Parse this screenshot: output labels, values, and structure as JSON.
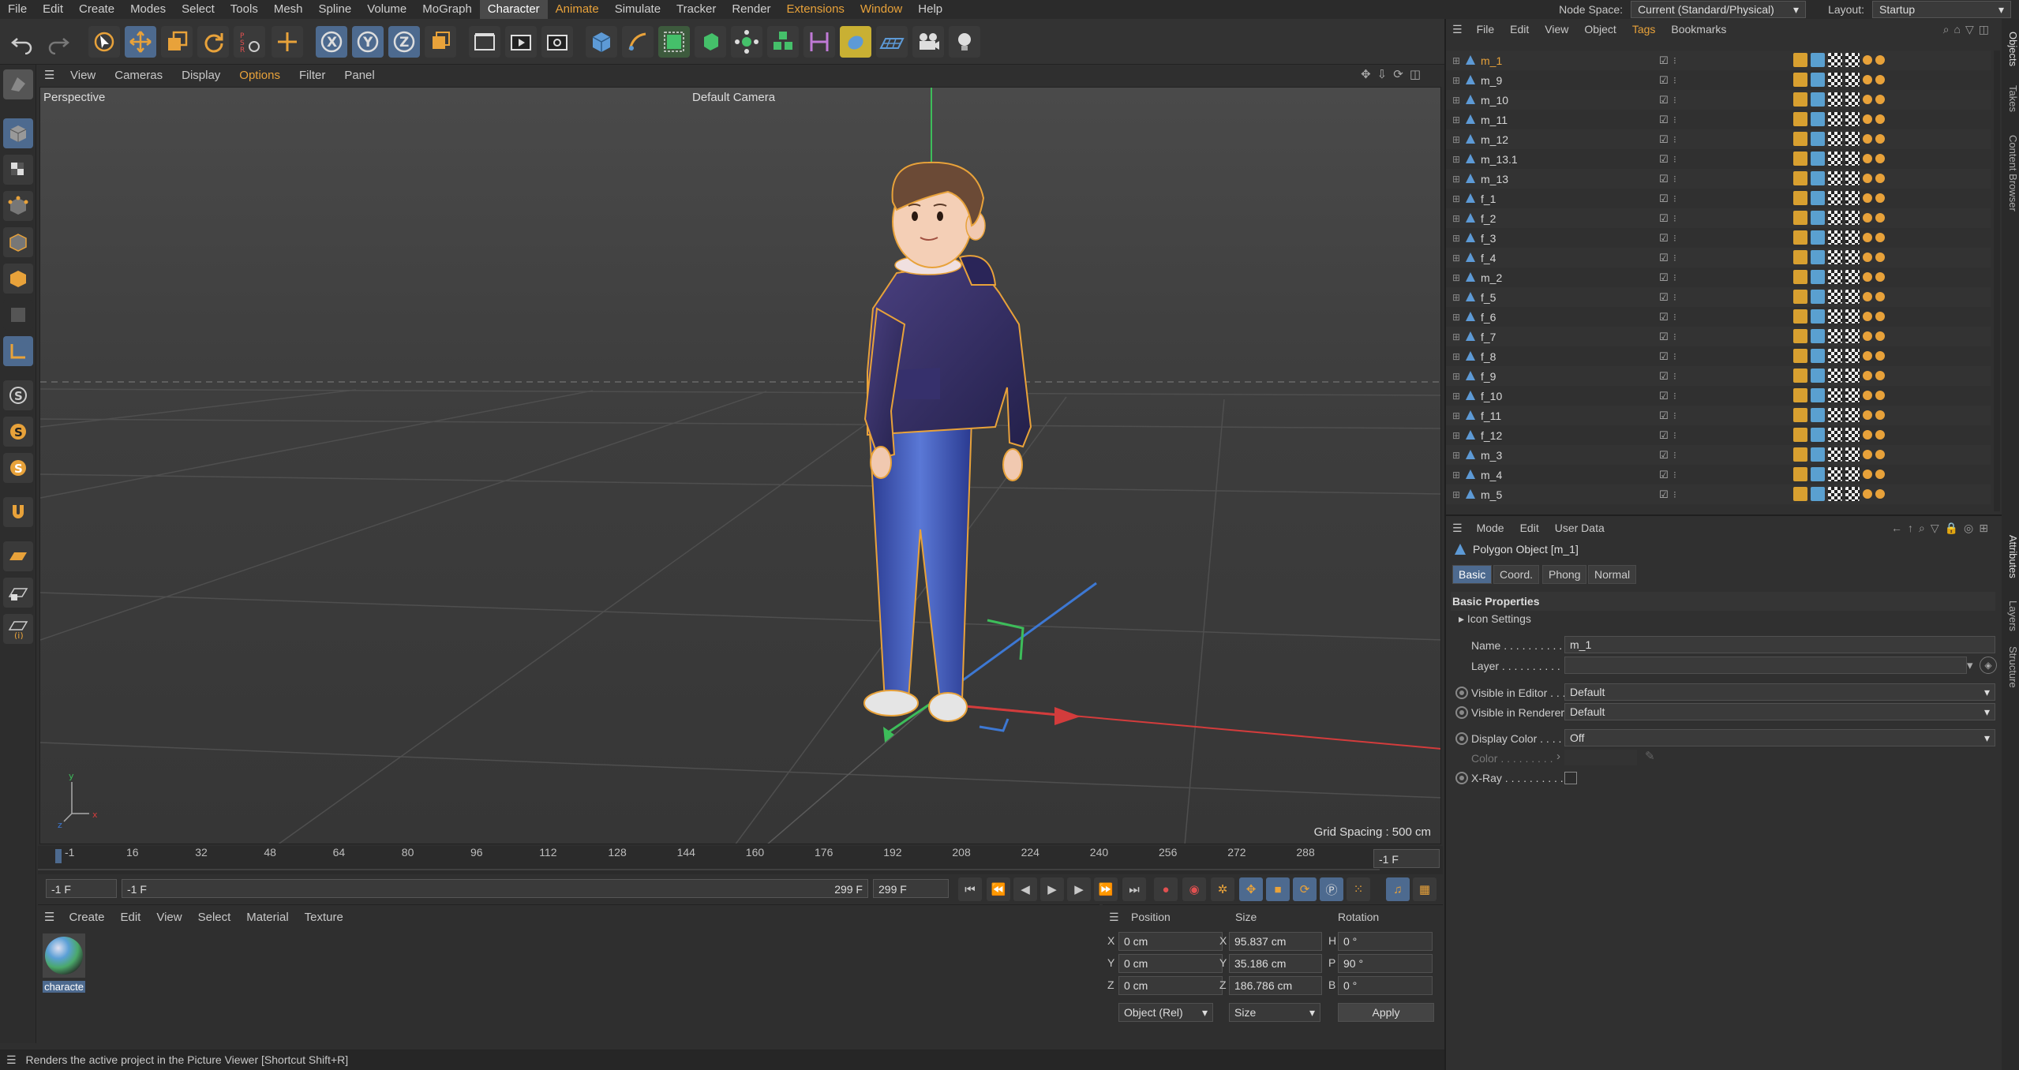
{
  "menubar": {
    "items": [
      "File",
      "Edit",
      "Create",
      "Modes",
      "Select",
      "Tools",
      "Mesh",
      "Spline",
      "Volume",
      "MoGraph",
      "Character",
      "Animate",
      "Simulate",
      "Tracker",
      "Render",
      "Extensions",
      "Window",
      "Help"
    ],
    "active": "Character",
    "node_space_label": "Node Space:",
    "node_space_value": "Current (Standard/Physical)",
    "layout_label": "Layout:",
    "layout_value": "Startup"
  },
  "viewport": {
    "menu": [
      "View",
      "Cameras",
      "Display",
      "Options",
      "Filter",
      "Panel"
    ],
    "view_name": "Perspective",
    "camera": "Default Camera",
    "grid_spacing": "Grid Spacing : 500 cm"
  },
  "timeline": {
    "ticks": [
      "-1",
      "16",
      "32",
      "48",
      "64",
      "80",
      "96",
      "112",
      "128",
      "144",
      "160",
      "176",
      "192",
      "208",
      "224",
      "240",
      "256",
      "272",
      "288"
    ],
    "current_frame": "-1 F",
    "start_field": "-1 F",
    "range_start": "-1 F",
    "range_end": "299 F",
    "end_field": "299 F"
  },
  "material_manager": {
    "menu": [
      "Create",
      "Edit",
      "View",
      "Select",
      "Material",
      "Texture"
    ],
    "material_name": "characte"
  },
  "coordinates": {
    "headers": [
      "Position",
      "Size",
      "Rotation"
    ],
    "rows": [
      {
        "axis": "X",
        "pos": "0 cm",
        "size_axis": "X",
        "size": "95.837 cm",
        "rot_axis": "H",
        "rot": "0 °"
      },
      {
        "axis": "Y",
        "pos": "0 cm",
        "size_axis": "Y",
        "size": "35.186 cm",
        "rot_axis": "P",
        "rot": "90 °"
      },
      {
        "axis": "Z",
        "pos": "0 cm",
        "size_axis": "Z",
        "size": "186.786 cm",
        "rot_axis": "B",
        "rot": "0 °"
      }
    ],
    "mode": "Object (Rel)",
    "size_mode": "Size",
    "apply": "Apply"
  },
  "status": "Renders the active project in the Picture Viewer [Shortcut Shift+R]",
  "object_manager": {
    "menu": [
      "File",
      "Edit",
      "View",
      "Object",
      "Tags",
      "Bookmarks"
    ],
    "objects": [
      "m_1",
      "m_9",
      "m_10",
      "m_11",
      "m_12",
      "m_13.1",
      "m_13",
      "f_1",
      "f_2",
      "f_3",
      "f_4",
      "m_2",
      "f_5",
      "f_6",
      "f_7",
      "f_8",
      "f_9",
      "f_10",
      "f_11",
      "f_12",
      "m_3",
      "m_4",
      "m_5"
    ],
    "selected": "m_1"
  },
  "attributes": {
    "menu": [
      "Mode",
      "Edit",
      "User Data"
    ],
    "object_title": "Polygon Object [m_1]",
    "tabs": [
      "Basic",
      "Coord.",
      "Phong",
      "Normal"
    ],
    "section": "Basic Properties",
    "icon_settings": "Icon Settings",
    "name_label": "Name . . . . . . . . . . .",
    "name_value": "m_1",
    "layer_label": "Layer . . . . . . . . . . .",
    "vis_editor_label": "Visible in Editor . . .",
    "vis_editor_value": "Default",
    "vis_renderer_label": "Visible in Renderer",
    "vis_renderer_value": "Default",
    "display_color_label": "Display Color . . . . .",
    "display_color_value": "Off",
    "color_label": "Color . . . . . . . . .",
    "xray_label": "X-Ray . . . . . . . . . ."
  },
  "side_tabs": [
    "Objects",
    "Takes",
    "Content Browser",
    "Attributes",
    "Layers",
    "Structure"
  ],
  "colors": {
    "accent": "#4d6a8f",
    "orange": "#e8a23a",
    "axis_x": "#d33c3c",
    "axis_y": "#3dbd5a",
    "axis_z": "#3d78d3"
  }
}
